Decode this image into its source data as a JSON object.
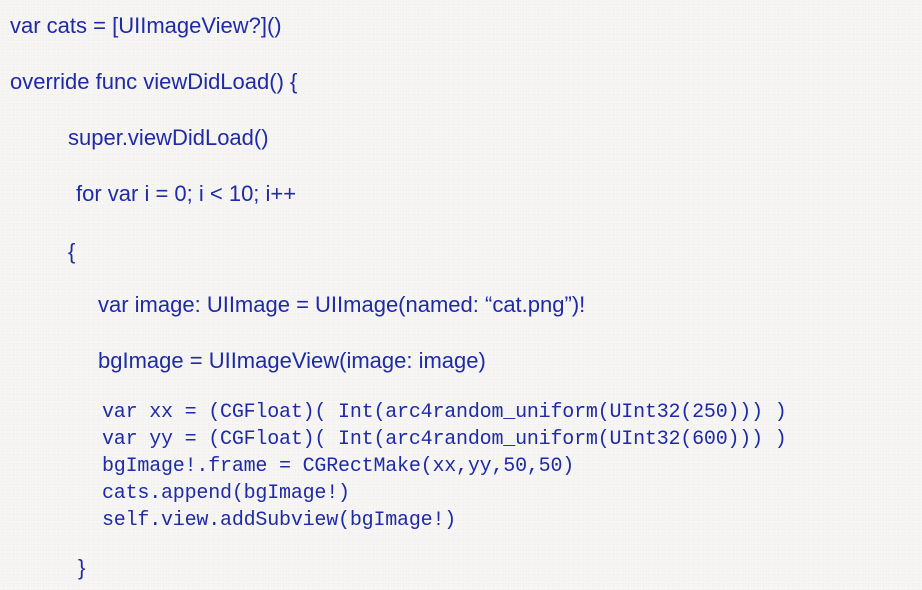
{
  "document": {
    "lines": [
      "var cats = [UIImageView?]()",
      "override func viewDidLoad() {",
      "super.viewDidLoad()",
      "for var i = 0; i < 10; i++",
      "{",
      "var image: UIImage = UIImage(named: “cat.png”)!",
      "bgImage = UIImageView(image: image)",
      "var xx = (CGFloat)( Int(arc4random_uniform(UInt32(250))) )",
      "var yy = (CGFloat)( Int(arc4random_uniform(UInt32(600))) )",
      "bgImage!.frame = CGRectMake(xx,yy,50,50)",
      "cats.append(bgImage!)",
      "self.view.addSubview(bgImage!)",
      "}"
    ],
    "text_color": "#1e2aa6",
    "background_color": "#f7f6f4"
  }
}
